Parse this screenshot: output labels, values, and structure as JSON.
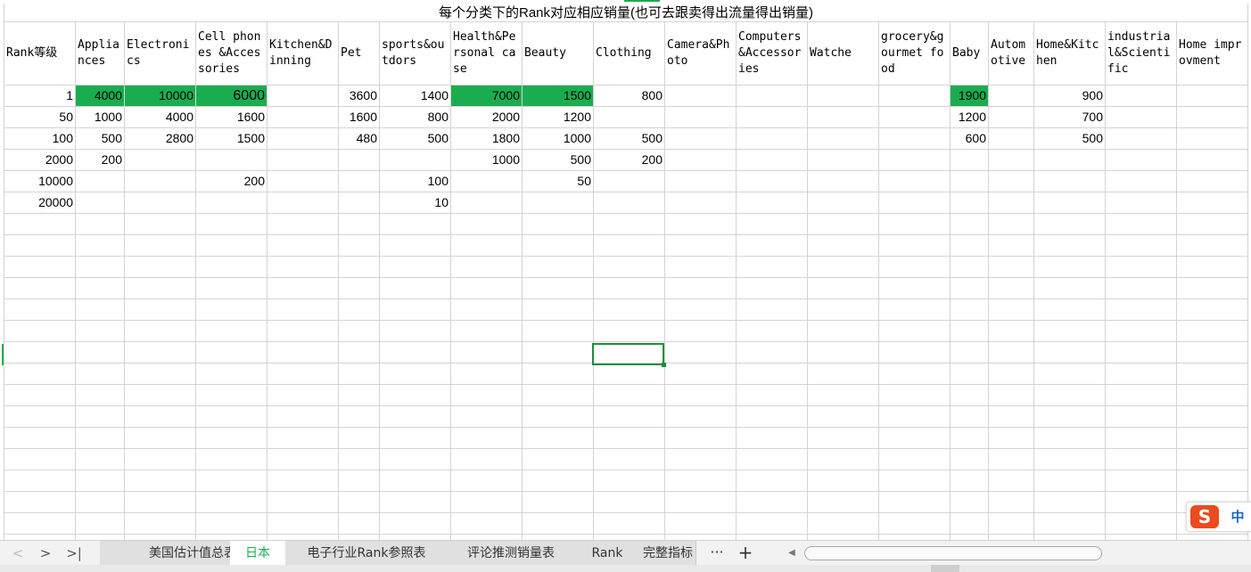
{
  "title": "每个分类下的Rank对应相应销量(也可去跟卖得出流量得出销量)",
  "headers": [
    "Rank等级",
    "Appliances",
    "Electronics",
    "Cell phones &Accessories",
    "Kitchen&Dinning",
    "Pet",
    "sports&outdors",
    "Health&Personal case",
    "Beauty",
    "Clothing",
    "Camera&Photo",
    "Computers &Accessories",
    "Watche",
    "grocery&gourmet food",
    "Baby",
    "Automotive",
    "Home&Kitchen",
    "industrial&Scientific",
    "Home improvment"
  ],
  "rows": [
    [
      "1",
      "4000",
      "10000",
      "6000",
      "",
      "3600",
      "1400",
      "7000",
      "1500",
      "800",
      "",
      "",
      "",
      "",
      "1900",
      "",
      "900",
      "",
      ""
    ],
    [
      "50",
      "1000",
      "4000",
      "1600",
      "",
      "1600",
      "800",
      "2000",
      "1200",
      "",
      "",
      "",
      "",
      "",
      "1200",
      "",
      "700",
      "",
      ""
    ],
    [
      "100",
      "500",
      "2800",
      "1500",
      "",
      "480",
      "500",
      "1800",
      "1000",
      "500",
      "",
      "",
      "",
      "",
      "600",
      "",
      "500",
      "",
      ""
    ],
    [
      "2000",
      "200",
      "",
      "",
      "",
      "",
      "",
      "1000",
      "500",
      "200",
      "",
      "",
      "",
      "",
      "",
      "",
      "",
      "",
      ""
    ],
    [
      "10000",
      "",
      "",
      "200",
      "",
      "",
      "100",
      "",
      "50",
      "",
      "",
      "",
      "",
      "",
      "",
      "",
      "",
      "",
      ""
    ],
    [
      "20000",
      "",
      "",
      "",
      "",
      "",
      "10",
      "",
      "",
      "",
      "",
      "",
      "",
      "",
      "",
      "",
      "",
      "",
      ""
    ]
  ],
  "highlight_color": "#1aad4f",
  "tabs": [
    "美国估计值总表",
    "日本",
    "电子行业Rank参照表",
    "评论推测销量表",
    "Rank",
    "完整指标"
  ],
  "active_tab": "日本",
  "tab_more_label": "···",
  "tab_add_label": "+",
  "nav": {
    "prev": "<",
    "next": ">",
    "last": ">|"
  },
  "ime": {
    "logo": "S",
    "mode": "中"
  }
}
